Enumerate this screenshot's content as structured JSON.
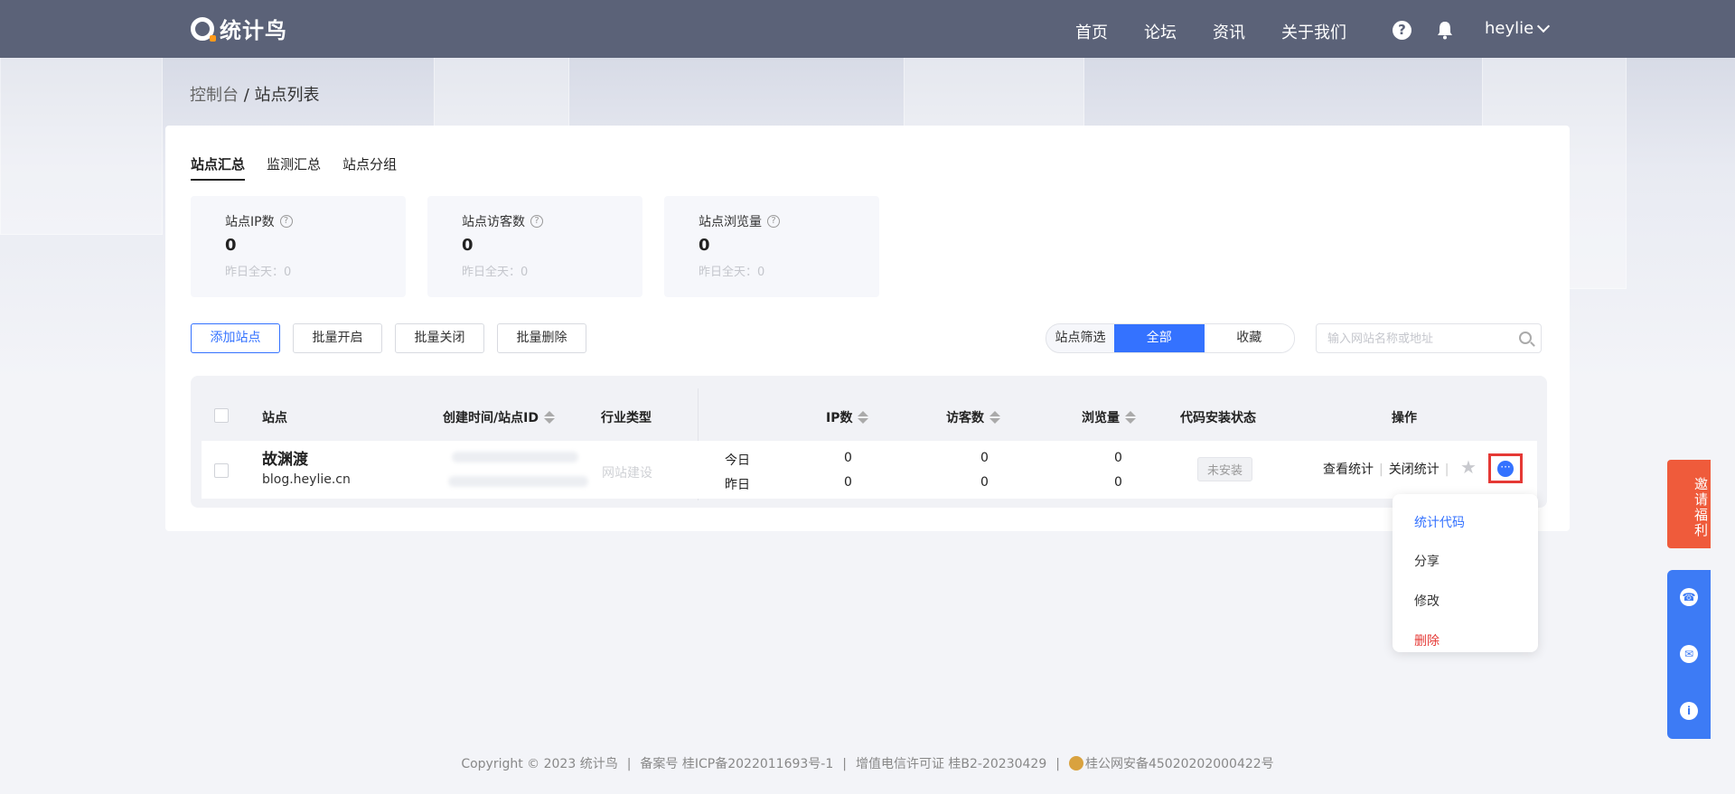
{
  "header": {
    "logo_text": "统计鸟",
    "nav": [
      "首页",
      "论坛",
      "资讯",
      "关于我们"
    ],
    "help_glyph": "?",
    "username": "heylie"
  },
  "breadcrumb": {
    "parent": "控制台",
    "sep": " / ",
    "current": "站点列表"
  },
  "tabs": [
    "站点汇总",
    "监测汇总",
    "站点分组"
  ],
  "stats": [
    {
      "label": "站点IP数",
      "value": "0",
      "sub": "昨日全天：0"
    },
    {
      "label": "站点访客数",
      "value": "0",
      "sub": "昨日全天：0"
    },
    {
      "label": "站点浏览量",
      "value": "0",
      "sub": "昨日全天：0"
    }
  ],
  "toolbar": {
    "add": "添加站点",
    "batch_open": "批量开启",
    "batch_close": "批量关闭",
    "batch_delete": "批量删除"
  },
  "filter": {
    "label": "站点筛选",
    "all": "全部",
    "fav": "收藏"
  },
  "search": {
    "placeholder": "输入网站名称或地址"
  },
  "table": {
    "headers": [
      "站点",
      "创建时间/站点ID",
      "行业类型",
      "IP数",
      "访客数",
      "浏览量",
      "代码安装状态",
      "操作"
    ],
    "row": {
      "name": "故渊渡",
      "url": "blog.heylie.cn",
      "industry": "网站建设",
      "today_label": "今日",
      "yesterday_label": "昨日",
      "ip_today": "0",
      "ip_yesterday": "0",
      "uv_today": "0",
      "uv_yesterday": "0",
      "pv_today": "0",
      "pv_yesterday": "0",
      "install_status": "未安装",
      "op_view": "查看统计",
      "op_close": "关闭统计",
      "more_glyph": "···"
    }
  },
  "dropdown": [
    "统计代码",
    "分享",
    "修改",
    "删除"
  ],
  "promo": "邀请福利",
  "footer": {
    "copyright": "Copyright © 2023 统计鸟",
    "icp": "备案号 桂ICP备2022011693号-1",
    "license": "增值电信许可证 桂B2-20230429",
    "police": "桂公网安备45020202000422号"
  },
  "colors": {
    "accent": "#3472ff",
    "danger": "#e53935",
    "header": "#5b6278",
    "promo": "#ef5b3b"
  }
}
